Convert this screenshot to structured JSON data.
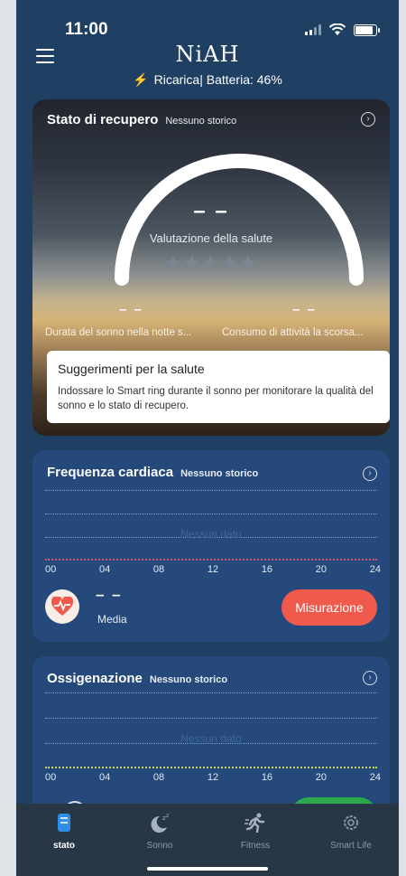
{
  "status_bar": {
    "time": "11:00",
    "battery_level": 0.8
  },
  "header": {
    "logo": "NiAH",
    "charging_status": "Ricarica| Batteria: 46%"
  },
  "recovery": {
    "title": "Stato di recupero",
    "history": "Nessuno storico",
    "score": "– –",
    "score_label": "Valutazione della salute",
    "stars": "★★★★★",
    "rating": 0,
    "sleep_value": "– –",
    "sleep_label": "Durata del sonno nella notte s...",
    "activity_value": "– –",
    "activity_label": "Consumo di attività la scorsa...",
    "tips_title": "Suggerimenti per la salute",
    "tips_text": "Indossare lo Smart ring durante il sonno per monitorare la qualità del sonno e lo stato di recupero."
  },
  "heart_rate": {
    "title": "Frequenza cardiaca",
    "history": "Nessuno storico",
    "no_data": "Nessun dato",
    "ticks": [
      "00",
      "04",
      "08",
      "12",
      "16",
      "20",
      "24"
    ],
    "value": "– –",
    "value_label": "Media",
    "measure_label": "Misurazione",
    "axis_color": "#d9566a"
  },
  "oxygen": {
    "title": "Ossigenazione",
    "history": "Nessuno storico",
    "no_data": "Nessun dato",
    "ticks": [
      "00",
      "04",
      "08",
      "12",
      "16",
      "20",
      "24"
    ],
    "axis_color": "#c8d84a"
  },
  "tabs": [
    {
      "label": "stato",
      "icon": "status-icon",
      "active": true
    },
    {
      "label": "Sonno",
      "icon": "sleep-icon",
      "active": false
    },
    {
      "label": "Fitness",
      "icon": "running-icon",
      "active": false
    },
    {
      "label": "Smart Life",
      "icon": "gear-icon",
      "active": false
    }
  ],
  "colors": {
    "background": "#1f3f63",
    "card": "#24497a",
    "accent_red": "#ef5a4c",
    "charge_green": "#4cd964"
  }
}
